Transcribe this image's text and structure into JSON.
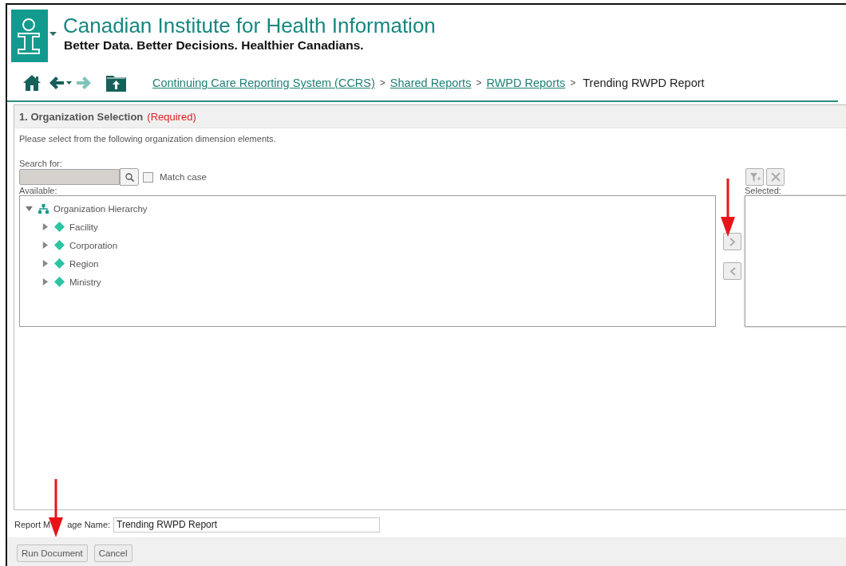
{
  "header": {
    "title": "Canadian Institute for Health Information",
    "tagline": "Better Data. Better Decisions. Healthier Canadians."
  },
  "breadcrumbs": [
    {
      "kind": "link",
      "label": "Continuing Care Reporting System (CCRS)"
    },
    {
      "kind": "separator",
      "label": ">"
    },
    {
      "kind": "link",
      "label": "Shared Reports"
    },
    {
      "kind": "separator",
      "label": ">"
    },
    {
      "kind": "link",
      "label": "RWPD Reports"
    },
    {
      "kind": "separator",
      "label": ">"
    },
    {
      "kind": "current",
      "label": "Trending RWPD Report"
    }
  ],
  "section": {
    "title": "1. Organization Selection",
    "required": "(Required)",
    "instructions": "Please select from the following organization dimension elements.",
    "search_label": "Search for:",
    "match_case": {
      "label": "Match case",
      "checked": false
    },
    "available_label": "Available:",
    "selected_label": "Selected:",
    "tree": {
      "label": "Organization Hierarchy",
      "expanded": true,
      "children": [
        {
          "label": "Facility",
          "expanded": false
        },
        {
          "label": "Corporation",
          "expanded": false
        },
        {
          "label": "Region",
          "expanded": false
        },
        {
          "label": "Ministry",
          "expanded": false
        }
      ]
    }
  },
  "report_name": {
    "label_parts": [
      "Report M",
      "age Name:"
    ],
    "value": "Trending RWPD Report"
  },
  "buttons": [
    "Run Document",
    "Cancel"
  ]
}
